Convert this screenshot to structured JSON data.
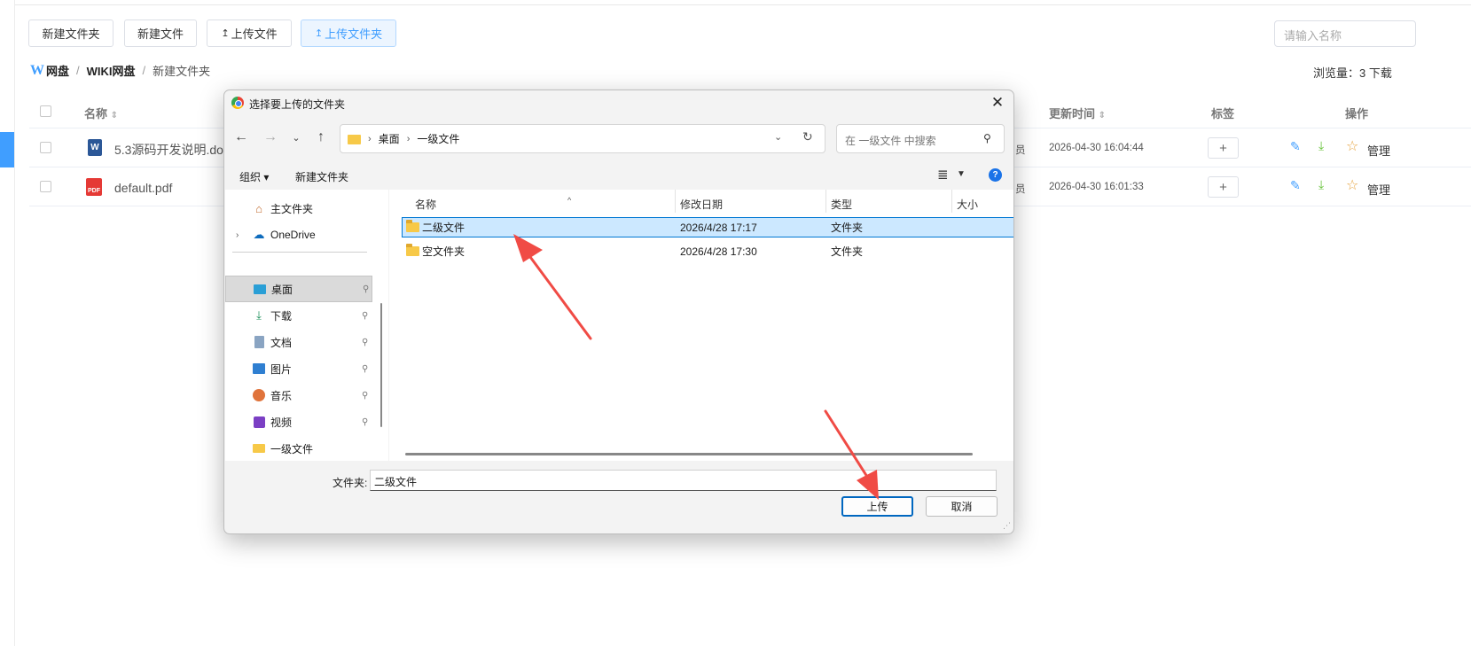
{
  "toolbar": {
    "new_folder": "新建文件夹",
    "new_file": "新建文件",
    "upload_file": "上传文件",
    "upload_folder": "上传文件夹",
    "search_placeholder": "请输入名称"
  },
  "breadcrumb": {
    "logo": "W",
    "root": "网盘",
    "sep1": "/",
    "level1": "WIKI网盘",
    "sep2": "/",
    "level2": "新建文件夹"
  },
  "stats": {
    "views": "浏览量：3  下载"
  },
  "table": {
    "headers": {
      "name": "名称",
      "updated": "更新时间",
      "tags": "标签",
      "actions": "操作"
    },
    "rows": [
      {
        "name": "5.3源码开发说明.docx",
        "owner_tail": "员",
        "updated": "2026-04-30 16:04:44",
        "tag_add": "+",
        "manage": "管理"
      },
      {
        "name": "default.pdf",
        "owner_tail": "员",
        "updated": "2026-04-30 16:01:33",
        "tag_add": "+",
        "manage": "管理"
      }
    ]
  },
  "dialog": {
    "title": "选择要上传的文件夹",
    "close": "✕",
    "path": {
      "seg1": "桌面",
      "seg2": "一级文件"
    },
    "search_placeholder": "在 一级文件 中搜索",
    "commands": {
      "organize": "组织 ▾",
      "new_folder": "新建文件夹"
    },
    "sidebar": [
      {
        "label": "主文件夹",
        "icon": "home-icon"
      },
      {
        "label": "OneDrive",
        "icon": "cloud-icon"
      },
      {
        "label": "桌面",
        "icon": "desktop-icon"
      },
      {
        "label": "下载",
        "icon": "download-icon"
      },
      {
        "label": "文档",
        "icon": "document-icon"
      },
      {
        "label": "图片",
        "icon": "picture-icon"
      },
      {
        "label": "音乐",
        "icon": "music-icon"
      },
      {
        "label": "视频",
        "icon": "video-icon"
      },
      {
        "label": "一级文件",
        "icon": "folder-icon"
      }
    ],
    "columns": {
      "name": "名称",
      "modified": "修改日期",
      "type": "类型",
      "size": "大小"
    },
    "files": [
      {
        "name": "二级文件",
        "modified": "2026/4/28 17:17",
        "type": "文件夹",
        "selected": true
      },
      {
        "name": "空文件夹",
        "modified": "2026/4/28 17:30",
        "type": "文件夹",
        "selected": false
      }
    ],
    "folder_label": "文件夹:",
    "folder_value": "二级文件",
    "upload_button": "上传",
    "cancel_button": "取消"
  },
  "colors": {
    "accent": "#409eff",
    "selection": "#cce8ff",
    "annotation_arrow": "#f04b45",
    "download_icon": "#67c23a",
    "star_icon": "#e6a23c"
  }
}
